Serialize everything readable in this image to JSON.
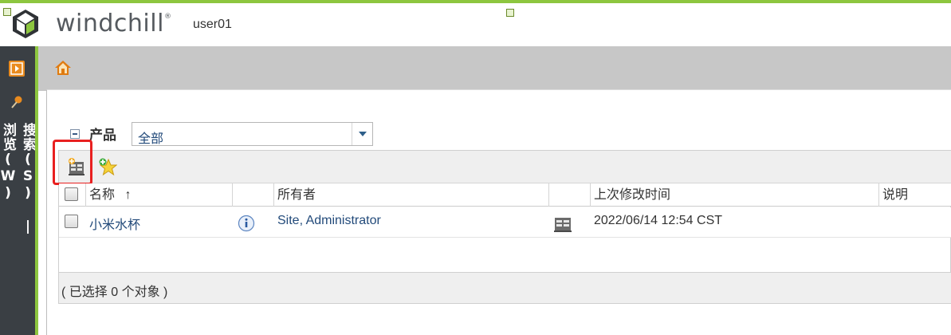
{
  "header": {
    "brand": "windchill",
    "trademark": "®",
    "user": "user01"
  },
  "navigator": {
    "label": "搜索(S) | 浏览(W)"
  },
  "filter": {
    "label": "产品",
    "selected": "全部"
  },
  "table": {
    "columns": {
      "name": "名称",
      "sort_indicator": "↑",
      "owner": "所有者",
      "modified": "上次修改时间",
      "description": "说明"
    },
    "rows": [
      {
        "name": "小米水杯",
        "owner": "Site, Administrator",
        "modified": "2022/06/14 12:54 CST",
        "description": ""
      }
    ],
    "footer": "( 已选择 0 个对象 )"
  },
  "colors": {
    "accent_green": "#8dc63f",
    "nav_dark": "#3a3f44",
    "link_blue": "#224a7a",
    "highlight_red": "#e82020",
    "home_orange": "#e07b10"
  },
  "icons": {
    "logo": "windchill-logo-icon",
    "nav_toggle": "expand-navigator-icon",
    "pin": "pin-icon",
    "home": "home-icon",
    "new_product": "new-product-icon",
    "favorite": "add-favorite-icon",
    "info": "info-icon",
    "product_type": "product-type-icon"
  }
}
